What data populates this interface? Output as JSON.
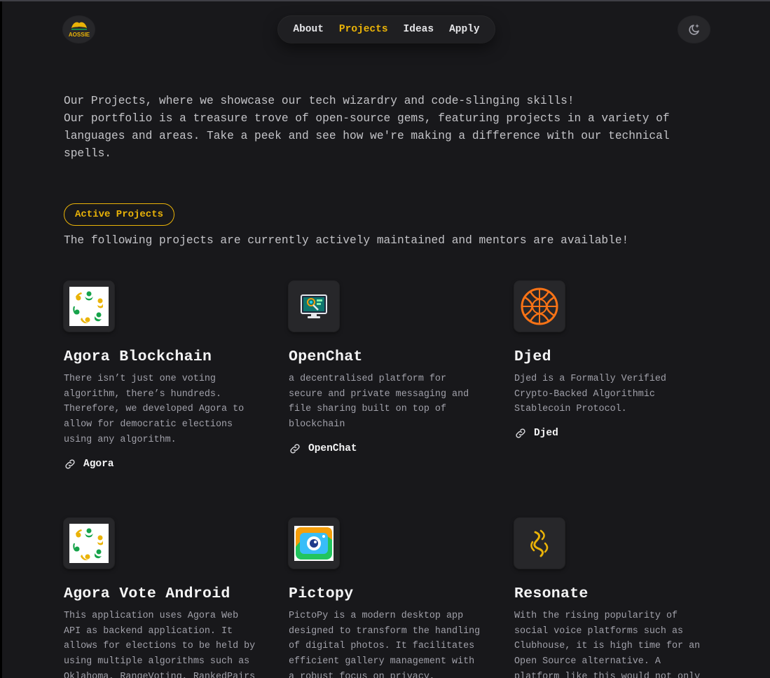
{
  "header": {
    "logo_text": "AOSSIE",
    "nav": [
      "About",
      "Projects",
      "Ideas",
      "Apply"
    ],
    "active_nav": "Projects",
    "theme_icon": "moon-sparkle-icon"
  },
  "intro": {
    "line1": "Our Projects, where we showcase our tech wizardry and code-slinging skills!",
    "line2": "Our portfolio is a treasure trove of open-source gems, featuring projects in a variety of languages and areas. Take a peek and see how we're making a difference with our technical spells."
  },
  "section": {
    "badge": "Active Projects",
    "subtitle": "The following projects are currently actively maintained and mentors are available!"
  },
  "projects": [
    {
      "title": "Agora Blockchain",
      "desc": "There isn’t just one voting algorithm, there’s hundreds. Therefore, we developed Agora to allow for democratic elections using any algorithm.",
      "link": "Agora",
      "icon": "agora-logo-icon"
    },
    {
      "title": "OpenChat",
      "desc": "a decentralised platform for secure and private messaging and file sharing built on top of blockchain",
      "link": "OpenChat",
      "icon": "openchat-logo-icon"
    },
    {
      "title": "Djed",
      "desc": "Djed is a Formally Verified Crypto-Backed Algorithmic Stablecoin Protocol.",
      "link": "Djed",
      "icon": "djed-logo-icon"
    },
    {
      "title": "Agora Vote Android",
      "desc": "This application uses Agora Web API as backend application. It allows for elections to be held by using multiple algorithms such as Oklahoma, RangeVoting, RankedPairs",
      "link": "",
      "icon": "agora-logo-icon"
    },
    {
      "title": "Pictopy",
      "desc": "PictoPy is a modern desktop app designed to transform the handling of digital photos. It facilitates efficient gallery management with a robust focus on privacy, offering",
      "link": "",
      "icon": "pictopy-logo-icon"
    },
    {
      "title": "Resonate",
      "desc": "With the rising popularity of social voice platforms such as Clubhouse, it is high time for an Open Source alternative. A platform like this would not only enhance credibility",
      "link": "",
      "icon": "resonate-logo-icon"
    }
  ],
  "colors": {
    "accent": "#eab308",
    "background": "#18181b",
    "card_icon_bg": "#27272a"
  }
}
